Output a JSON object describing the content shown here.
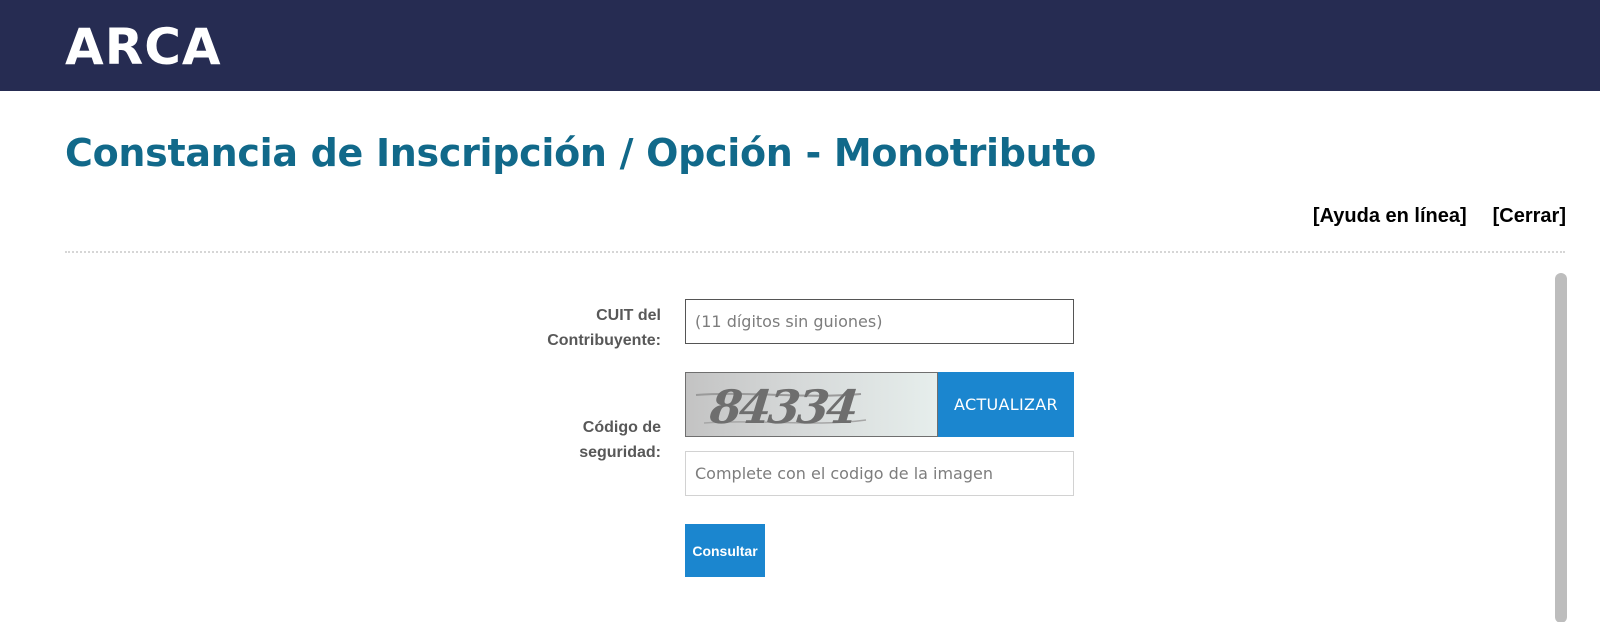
{
  "header": {
    "logo_text": "ARCA",
    "background_color": "#262c52"
  },
  "page": {
    "title": "Constancia de Inscripción / Opción - Monotributo",
    "title_color": "#11698a"
  },
  "links": {
    "help": "[Ayuda en línea]",
    "close": "[Cerrar]"
  },
  "form": {
    "cuit": {
      "label_line1": "CUIT del",
      "label_line2": "Contribuyente:",
      "value": "",
      "placeholder": "(11 dígitos sin guiones)"
    },
    "security": {
      "label_line1": "Código de",
      "label_line2": "seguridad:",
      "captcha_text": "84334",
      "refresh_label": "ACTUALIZAR",
      "value": "",
      "placeholder": "Complete con el codigo de la imagen"
    },
    "submit_label": "Consultar",
    "accent_color": "#1b86cf"
  }
}
